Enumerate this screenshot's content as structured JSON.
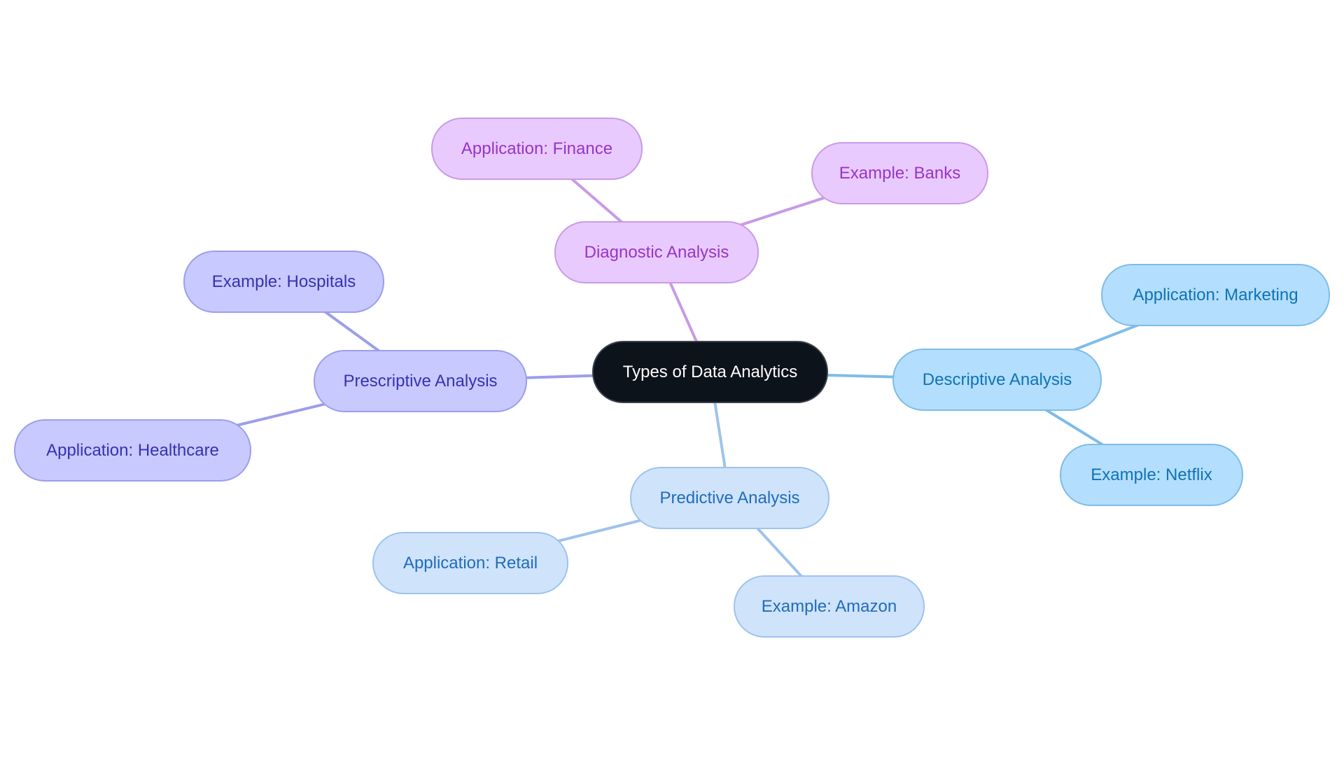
{
  "diagram": {
    "type": "mindmap",
    "root": {
      "id": "root",
      "label": "Types of Data Analytics"
    },
    "branches": [
      {
        "id": "diagnostic",
        "label": "Diagnostic Analysis",
        "color_fill": "#e9caff",
        "color_stroke": "#c79be6",
        "color_text": "#9734c7",
        "children": [
          {
            "id": "diag-app",
            "label": "Application: Finance"
          },
          {
            "id": "diag-ex",
            "label": "Example: Banks"
          }
        ]
      },
      {
        "id": "descriptive",
        "label": "Descriptive Analysis",
        "color_fill": "#b3defd",
        "color_stroke": "#7ebce8",
        "color_text": "#0f73b6",
        "children": [
          {
            "id": "desc-app",
            "label": "Application: Marketing"
          },
          {
            "id": "desc-ex",
            "label": "Example: Netflix"
          }
        ]
      },
      {
        "id": "predictive",
        "label": "Predictive Analysis",
        "color_fill": "#cfe3fb",
        "color_stroke": "#9ec3ec",
        "color_text": "#1f6cbc",
        "children": [
          {
            "id": "pred-app",
            "label": "Application: Retail"
          },
          {
            "id": "pred-ex",
            "label": "Example: Amazon"
          }
        ]
      },
      {
        "id": "prescriptive",
        "label": "Prescriptive Analysis",
        "color_fill": "#c8c9ff",
        "color_stroke": "#9c9eeb",
        "color_text": "#3433b0",
        "children": [
          {
            "id": "pres-ex",
            "label": "Example: Hospitals"
          },
          {
            "id": "pres-app",
            "label": "Application: Healthcare"
          }
        ]
      }
    ],
    "edges": [
      {
        "from": "root",
        "to": "diagnostic",
        "color": "#c79be6"
      },
      {
        "from": "diagnostic",
        "to": "diag-app",
        "color": "#c79be6"
      },
      {
        "from": "diagnostic",
        "to": "diag-ex",
        "color": "#c79be6"
      },
      {
        "from": "root",
        "to": "descriptive",
        "color": "#7ebce8"
      },
      {
        "from": "descriptive",
        "to": "desc-app",
        "color": "#7ebce8"
      },
      {
        "from": "descriptive",
        "to": "desc-ex",
        "color": "#7ebce8"
      },
      {
        "from": "root",
        "to": "predictive",
        "color": "#9ec3ec"
      },
      {
        "from": "predictive",
        "to": "pred-app",
        "color": "#9ec3ec"
      },
      {
        "from": "predictive",
        "to": "pred-ex",
        "color": "#9ec3ec"
      },
      {
        "from": "root",
        "to": "prescriptive",
        "color": "#9c9eeb"
      },
      {
        "from": "prescriptive",
        "to": "pres-ex",
        "color": "#9c9eeb"
      },
      {
        "from": "prescriptive",
        "to": "pres-app",
        "color": "#9c9eeb"
      }
    ]
  }
}
